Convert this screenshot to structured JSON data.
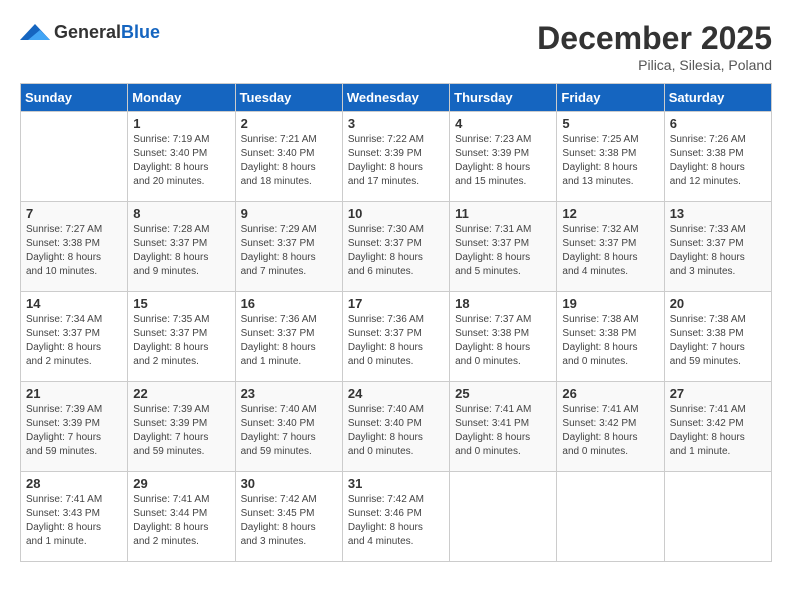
{
  "header": {
    "logo_general": "General",
    "logo_blue": "Blue",
    "month_title": "December 2025",
    "location": "Pilica, Silesia, Poland"
  },
  "days_of_week": [
    "Sunday",
    "Monday",
    "Tuesday",
    "Wednesday",
    "Thursday",
    "Friday",
    "Saturday"
  ],
  "weeks": [
    [
      {
        "day": "",
        "info": ""
      },
      {
        "day": "1",
        "info": "Sunrise: 7:19 AM\nSunset: 3:40 PM\nDaylight: 8 hours\nand 20 minutes."
      },
      {
        "day": "2",
        "info": "Sunrise: 7:21 AM\nSunset: 3:40 PM\nDaylight: 8 hours\nand 18 minutes."
      },
      {
        "day": "3",
        "info": "Sunrise: 7:22 AM\nSunset: 3:39 PM\nDaylight: 8 hours\nand 17 minutes."
      },
      {
        "day": "4",
        "info": "Sunrise: 7:23 AM\nSunset: 3:39 PM\nDaylight: 8 hours\nand 15 minutes."
      },
      {
        "day": "5",
        "info": "Sunrise: 7:25 AM\nSunset: 3:38 PM\nDaylight: 8 hours\nand 13 minutes."
      },
      {
        "day": "6",
        "info": "Sunrise: 7:26 AM\nSunset: 3:38 PM\nDaylight: 8 hours\nand 12 minutes."
      }
    ],
    [
      {
        "day": "7",
        "info": "Sunrise: 7:27 AM\nSunset: 3:38 PM\nDaylight: 8 hours\nand 10 minutes."
      },
      {
        "day": "8",
        "info": "Sunrise: 7:28 AM\nSunset: 3:37 PM\nDaylight: 8 hours\nand 9 minutes."
      },
      {
        "day": "9",
        "info": "Sunrise: 7:29 AM\nSunset: 3:37 PM\nDaylight: 8 hours\nand 7 minutes."
      },
      {
        "day": "10",
        "info": "Sunrise: 7:30 AM\nSunset: 3:37 PM\nDaylight: 8 hours\nand 6 minutes."
      },
      {
        "day": "11",
        "info": "Sunrise: 7:31 AM\nSunset: 3:37 PM\nDaylight: 8 hours\nand 5 minutes."
      },
      {
        "day": "12",
        "info": "Sunrise: 7:32 AM\nSunset: 3:37 PM\nDaylight: 8 hours\nand 4 minutes."
      },
      {
        "day": "13",
        "info": "Sunrise: 7:33 AM\nSunset: 3:37 PM\nDaylight: 8 hours\nand 3 minutes."
      }
    ],
    [
      {
        "day": "14",
        "info": "Sunrise: 7:34 AM\nSunset: 3:37 PM\nDaylight: 8 hours\nand 2 minutes."
      },
      {
        "day": "15",
        "info": "Sunrise: 7:35 AM\nSunset: 3:37 PM\nDaylight: 8 hours\nand 2 minutes."
      },
      {
        "day": "16",
        "info": "Sunrise: 7:36 AM\nSunset: 3:37 PM\nDaylight: 8 hours\nand 1 minute."
      },
      {
        "day": "17",
        "info": "Sunrise: 7:36 AM\nSunset: 3:37 PM\nDaylight: 8 hours\nand 0 minutes."
      },
      {
        "day": "18",
        "info": "Sunrise: 7:37 AM\nSunset: 3:38 PM\nDaylight: 8 hours\nand 0 minutes."
      },
      {
        "day": "19",
        "info": "Sunrise: 7:38 AM\nSunset: 3:38 PM\nDaylight: 8 hours\nand 0 minutes."
      },
      {
        "day": "20",
        "info": "Sunrise: 7:38 AM\nSunset: 3:38 PM\nDaylight: 7 hours\nand 59 minutes."
      }
    ],
    [
      {
        "day": "21",
        "info": "Sunrise: 7:39 AM\nSunset: 3:39 PM\nDaylight: 7 hours\nand 59 minutes."
      },
      {
        "day": "22",
        "info": "Sunrise: 7:39 AM\nSunset: 3:39 PM\nDaylight: 7 hours\nand 59 minutes."
      },
      {
        "day": "23",
        "info": "Sunrise: 7:40 AM\nSunset: 3:40 PM\nDaylight: 7 hours\nand 59 minutes."
      },
      {
        "day": "24",
        "info": "Sunrise: 7:40 AM\nSunset: 3:40 PM\nDaylight: 8 hours\nand 0 minutes."
      },
      {
        "day": "25",
        "info": "Sunrise: 7:41 AM\nSunset: 3:41 PM\nDaylight: 8 hours\nand 0 minutes."
      },
      {
        "day": "26",
        "info": "Sunrise: 7:41 AM\nSunset: 3:42 PM\nDaylight: 8 hours\nand 0 minutes."
      },
      {
        "day": "27",
        "info": "Sunrise: 7:41 AM\nSunset: 3:42 PM\nDaylight: 8 hours\nand 1 minute."
      }
    ],
    [
      {
        "day": "28",
        "info": "Sunrise: 7:41 AM\nSunset: 3:43 PM\nDaylight: 8 hours\nand 1 minute."
      },
      {
        "day": "29",
        "info": "Sunrise: 7:41 AM\nSunset: 3:44 PM\nDaylight: 8 hours\nand 2 minutes."
      },
      {
        "day": "30",
        "info": "Sunrise: 7:42 AM\nSunset: 3:45 PM\nDaylight: 8 hours\nand 3 minutes."
      },
      {
        "day": "31",
        "info": "Sunrise: 7:42 AM\nSunset: 3:46 PM\nDaylight: 8 hours\nand 4 minutes."
      },
      {
        "day": "",
        "info": ""
      },
      {
        "day": "",
        "info": ""
      },
      {
        "day": "",
        "info": ""
      }
    ]
  ]
}
